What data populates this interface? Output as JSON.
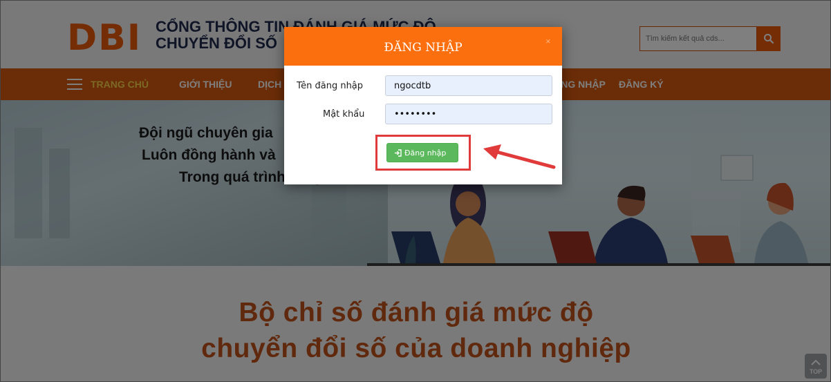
{
  "header": {
    "logo": {
      "mark": "DBI",
      "line1": "CỔNG THÔNG TIN ĐÁNH GIÁ MỨC ĐỘ",
      "line2": "CHUYỂN ĐỔI SỐ"
    },
    "search": {
      "placeholder": "Tìm kiếm kết quả cds...",
      "icon": "search-icon"
    }
  },
  "nav": {
    "menu_icon": "menu-icon",
    "items": [
      {
        "label": "TRANG CHỦ",
        "active": true
      },
      {
        "label": "GIỚI THIỆU"
      },
      {
        "label": "DỊCH VỤ"
      },
      {
        "label": "ĐĂNG NHẬP"
      },
      {
        "label": "ĐĂNG KÝ"
      }
    ]
  },
  "hero": {
    "lines": [
      "Đội ngũ chuyên gia",
      "Luôn đồng hành và",
      "Trong quá trình chuyển đổi số"
    ]
  },
  "main": {
    "title_line1": "Bộ chỉ số đánh giá mức độ",
    "title_line2": "chuyển đổi số của doanh nghiệp"
  },
  "top_button": {
    "label": "TOP"
  },
  "modal": {
    "title": "ĐĂNG NHẬP",
    "close": "×",
    "username_label": "Tên đăng nhập",
    "username_value": "ngocdtb",
    "password_label": "Mật khẩu",
    "password_value": "12345678",
    "submit_label": "Đăng nhập",
    "submit_icon": "sign-in-icon"
  },
  "colors": {
    "brand_orange": "#ea5b0c",
    "nav_bg": "#d75a0f",
    "modal_header": "#fb6f0f",
    "submit_green": "#5cb85c",
    "annotation_red": "#e03a3a"
  }
}
